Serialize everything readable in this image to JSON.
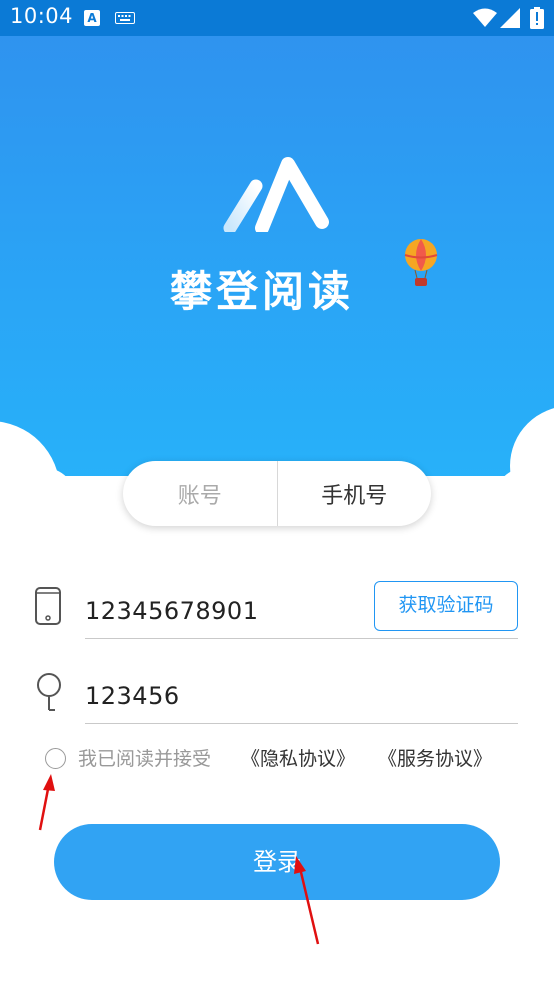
{
  "status_bar": {
    "time": "10:04",
    "input_indicator": "A"
  },
  "header": {
    "app_name": "攀登阅读"
  },
  "login_tabs": [
    {
      "label": "账号",
      "selected": false
    },
    {
      "label": "手机号",
      "selected": true
    }
  ],
  "form": {
    "phone_value": "12345678901",
    "code_value": "123456",
    "get_code_label": "获取验证码"
  },
  "agreement": {
    "checked": false,
    "prefix": "我已阅读并接受",
    "privacy_link": "《隐私协议》",
    "service_link": "《服务协议》"
  },
  "login_button": {
    "label": "登录"
  },
  "colors": {
    "status_bar": "#0b7ad6",
    "hero_top": "#2f93ef",
    "hero_bottom": "#27b3fa",
    "accent": "#2196f3",
    "button": "#31a3f3",
    "annotation_arrow": "#e01010"
  },
  "icons": [
    "wifi-icon",
    "signal-icon",
    "battery-icon",
    "phone-icon",
    "key-icon",
    "balloon-icon",
    "logo-icon"
  ]
}
